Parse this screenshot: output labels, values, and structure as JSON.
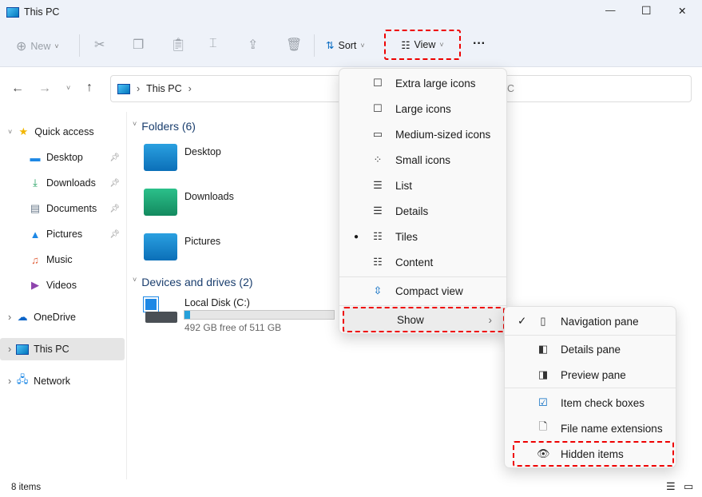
{
  "window": {
    "title": "This PC",
    "minimize": "—",
    "maximize": "☐",
    "close": "✕"
  },
  "toolbar": {
    "new_label": "New",
    "sort_label": "Sort",
    "view_label": "View",
    "more": "···"
  },
  "address": {
    "path": [
      "This PC"
    ],
    "search_hint": "C"
  },
  "sidebar": {
    "items": [
      {
        "label": "Quick access",
        "icon": "star-icon"
      },
      {
        "label": "Desktop",
        "icon": "desktop-icon",
        "pinned": true
      },
      {
        "label": "Downloads",
        "icon": "download-icon",
        "pinned": true
      },
      {
        "label": "Documents",
        "icon": "document-icon",
        "pinned": true
      },
      {
        "label": "Pictures",
        "icon": "picture-icon",
        "pinned": true
      },
      {
        "label": "Music",
        "icon": "music-icon"
      },
      {
        "label": "Videos",
        "icon": "video-icon"
      },
      {
        "label": "OneDrive",
        "icon": "cloud-icon"
      },
      {
        "label": "This PC",
        "icon": "pc-icon",
        "selected": true
      },
      {
        "label": "Network",
        "icon": "network-icon"
      }
    ]
  },
  "content": {
    "folders_header": "Folders (6)",
    "folders": [
      "Desktop",
      "Downloads",
      "Pictures"
    ],
    "drives_header": "Devices and drives (2)",
    "drive": {
      "name": "Local Disk (C:)",
      "free": "492 GB free of 511 GB",
      "used_fraction": 0.037
    }
  },
  "view_menu": {
    "items": [
      "Extra large icons",
      "Large icons",
      "Medium-sized icons",
      "Small icons",
      "List",
      "Details",
      "Tiles",
      "Content"
    ],
    "selected": "Tiles",
    "compact": "Compact view",
    "show": "Show"
  },
  "show_menu": {
    "items": [
      {
        "label": "Navigation pane",
        "checked": true
      },
      {
        "label": "Details pane"
      },
      {
        "label": "Preview pane"
      },
      {
        "label": "Item check boxes"
      },
      {
        "label": "File name extensions"
      },
      {
        "label": "Hidden items"
      }
    ]
  },
  "status": {
    "count": "8 items"
  },
  "colors": {
    "highlight": "#e00000",
    "accent": "#0067c0"
  }
}
